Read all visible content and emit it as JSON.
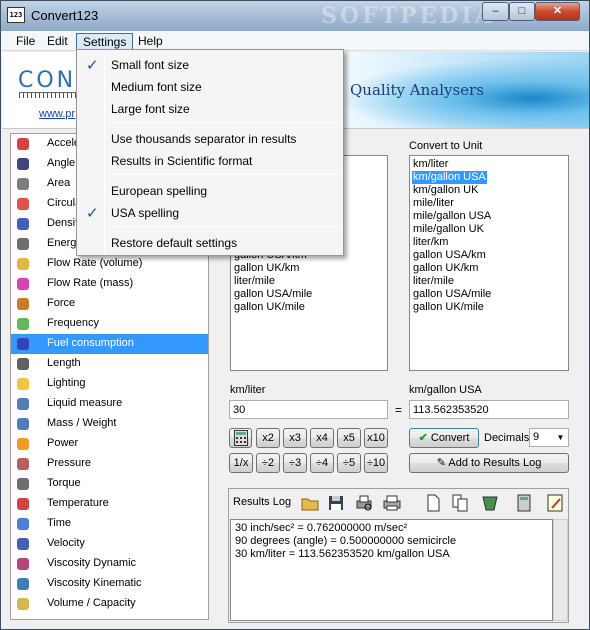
{
  "window": {
    "title": "Convert123",
    "icon_text": "123",
    "watermark": "SOFTPEDIA",
    "buttons": {
      "minimize": "–",
      "maximize": "□",
      "close": "✕"
    }
  },
  "menu": [
    "File",
    "Edit",
    "Settings",
    "Help"
  ],
  "banner": {
    "logo": "CONV",
    "url": "www.pr",
    "tagline": "Quality Analysers"
  },
  "categories": [
    {
      "label": "Acceleration",
      "icon": "rocket-icon"
    },
    {
      "label": "Angle",
      "icon": "angle-icon"
    },
    {
      "label": "Area",
      "icon": "grid-icon"
    },
    {
      "label": "Circular",
      "icon": "circle-icon"
    },
    {
      "label": "Density",
      "icon": "density-icon"
    },
    {
      "label": "Energy",
      "icon": "energy-icon"
    },
    {
      "label": "Flow Rate (volume)",
      "icon": "tap-icon"
    },
    {
      "label": "Flow Rate (mass)",
      "icon": "pipe-icon"
    },
    {
      "label": "Force",
      "icon": "force-icon"
    },
    {
      "label": "Frequency",
      "icon": "wave-icon"
    },
    {
      "label": "Fuel consumption",
      "icon": "fuel-icon"
    },
    {
      "label": "Length",
      "icon": "ruler-icon"
    },
    {
      "label": "Lighting",
      "icon": "bulb-icon"
    },
    {
      "label": "Liquid measure",
      "icon": "barrel-icon"
    },
    {
      "label": "Mass / Weight",
      "icon": "dumbbell-icon"
    },
    {
      "label": "Power",
      "icon": "power-icon"
    },
    {
      "label": "Pressure",
      "icon": "gauge-icon"
    },
    {
      "label": "Torque",
      "icon": "wrench-icon"
    },
    {
      "label": "Temperature",
      "icon": "thermometer-icon"
    },
    {
      "label": "Time",
      "icon": "clock-icon"
    },
    {
      "label": "Velocity",
      "icon": "car-icon"
    },
    {
      "label": "Viscosity Dynamic",
      "icon": "drop-icon"
    },
    {
      "label": "Viscosity Kinematic",
      "icon": "funnel-icon"
    },
    {
      "label": "Volume / Capacity",
      "icon": "cube-icon"
    }
  ],
  "selected_category": "Fuel consumption",
  "from_list": {
    "visible_items": [
      "gallon USA/km",
      "gallon UK/km",
      "liter/mile",
      "gallon USA/mile",
      "gallon UK/mile"
    ]
  },
  "to_list": {
    "label": "Convert to Unit",
    "items": [
      "km/liter",
      "km/gallon USA",
      "km/gallon UK",
      "mile/liter",
      "mile/gallon USA",
      "mile/gallon UK",
      "liter/km",
      "gallon USA/km",
      "gallon UK/km",
      "liter/mile",
      "gallon USA/mile",
      "gallon UK/mile"
    ],
    "selected": "km/gallon USA"
  },
  "from_unit_label": "km/liter",
  "to_unit_label": "km/gallon USA",
  "from_value": "30",
  "to_value": "113.562353520",
  "equals": "=",
  "ops": [
    "x2",
    "x3",
    "x4",
    "x5",
    "x10",
    "1/x",
    "÷2",
    "÷3",
    "÷4",
    "÷5",
    "÷10"
  ],
  "convert_label": "Convert",
  "decimals_label": "Decimals",
  "decimals_value": "9",
  "add_log_label": "Add to Results Log",
  "results_log": {
    "label": "Results Log",
    "lines": [
      "30 inch/sec² = 0.762000000 m/sec²",
      "90 degrees (angle) = 0.500000000 semicircle",
      "30 km/liter = 113.562353520 km/gallon USA"
    ]
  },
  "settings_menu": {
    "items": [
      {
        "label": "Small font size",
        "checked": "✓"
      },
      {
        "label": "Medium font size",
        "checked": ""
      },
      {
        "label": "Large font size",
        "checked": ""
      },
      {
        "label": "Use thousands separator in results",
        "checked": ""
      },
      {
        "label": "Results in Scientific format",
        "checked": ""
      },
      {
        "label": "European spelling",
        "checked": ""
      },
      {
        "label": "USA spelling",
        "checked": "✓"
      },
      {
        "label": "Restore default settings",
        "checked": ""
      }
    ]
  },
  "colors": {
    "selection": "#3399ff",
    "title_gradient_top": "#c3d4e6",
    "close_button": "#c84a2d",
    "banner_blue": "#2e6fb8"
  }
}
